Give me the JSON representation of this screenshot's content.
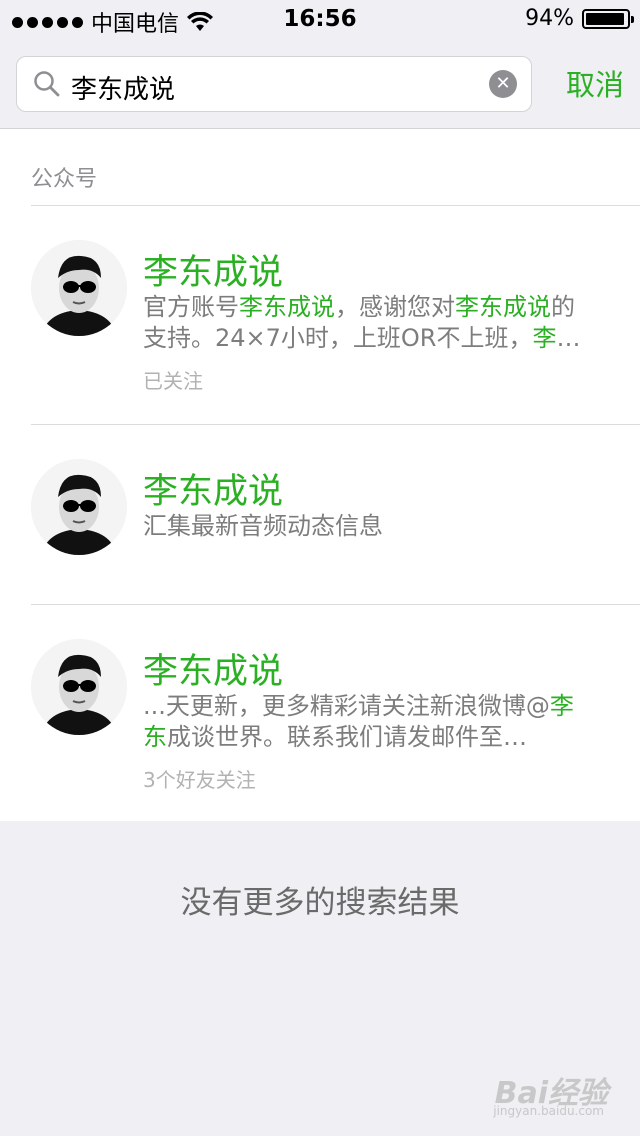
{
  "status_bar": {
    "carrier": "中国电信",
    "time": "16:56",
    "battery": "94%",
    "battery_level": 0.94
  },
  "search": {
    "query": "李东成说",
    "cancel_label": "取消",
    "icon": "search-icon",
    "clear_icon": "clear-icon"
  },
  "results": {
    "section_title": "公众号",
    "items": [
      {
        "name": "李东成说",
        "desc_line1_pre": "官方账号",
        "desc_line1_hl1": "李东成说",
        "desc_line1_mid": "，感谢您对",
        "desc_line1_hl2": "李东成说",
        "desc_line1_post": "的",
        "desc_line2_pre": "支持。24×7小时，上班OR不上班，",
        "desc_line2_hl": "李",
        "desc_line2_post": "…",
        "meta": "已关注"
      },
      {
        "name": "李东成说",
        "desc": "汇集最新音频动态信息"
      },
      {
        "name": "李东成说",
        "desc_line1_pre": "...天更新，更多精彩请关注新浪微博@",
        "desc_line1_hl": "李",
        "desc_line2_hl": "东",
        "desc_line2_post": "成谈世界。联系我们请发邮件至…",
        "meta": "3个好友关注"
      }
    ]
  },
  "footer": {
    "no_more": "没有更多的搜索结果"
  },
  "watermark": {
    "brand": "Bai经验",
    "url": "jingyan.baidu.com"
  },
  "colors": {
    "accent": "#2bb024",
    "background": "#efeff4",
    "muted": "#8e8e93"
  }
}
